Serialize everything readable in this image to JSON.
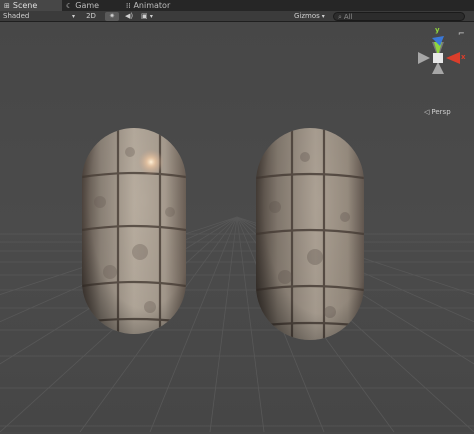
{
  "tabs": [
    {
      "label": "Scene",
      "icon": "scene-icon"
    },
    {
      "label": "Game",
      "icon": "game-icon"
    },
    {
      "label": "Animator",
      "icon": "animator-icon"
    }
  ],
  "toolbar": {
    "shading_mode": "Shaded",
    "mode_2d": "2D",
    "gizmos_label": "Gizmos",
    "search_placeholder": "All"
  },
  "gizmo": {
    "y_label": "y",
    "x_label": "x",
    "projection": "Persp",
    "colors": {
      "x": "#db3e2b",
      "y": "#8fd43d",
      "z": "#3a78d8"
    }
  }
}
